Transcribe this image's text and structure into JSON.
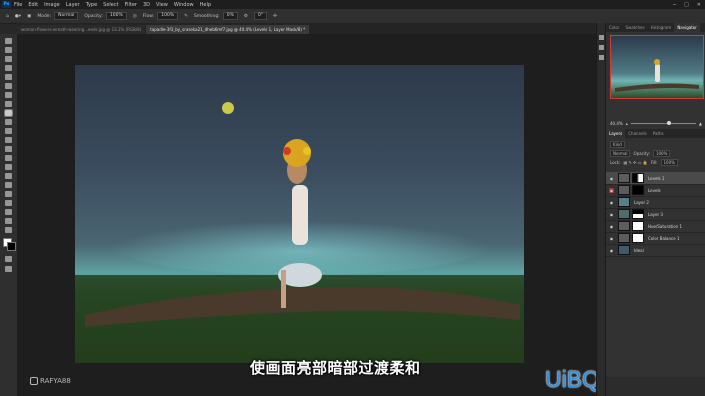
{
  "menu": [
    "File",
    "Edit",
    "Image",
    "Layer",
    "Type",
    "Select",
    "Filter",
    "3D",
    "View",
    "Window",
    "Help"
  ],
  "app_logo": "Ps",
  "options": {
    "mode_label": "Mode:",
    "mode_value": "Normal",
    "opacity_label": "Opacity:",
    "opacity_value": "100%",
    "flow_label": "Flow:",
    "flow_value": "100%",
    "smoothing_label": "Smoothing:",
    "smoothing_value": "0%",
    "angle_value": "0°"
  },
  "doc_tabs": [
    "woman-flowers-wreath-wearing...eeds.jpg @ 13.1% (RGB/8)",
    "tapadle-3f3_by_sraseka21_dheb6mf7.jpg @ 40.4% (Levels 1, Layer Mask/8) *"
  ],
  "panels": {
    "top_tabs": [
      "Color",
      "Swatches",
      "Histogram",
      "Navigator"
    ],
    "zoom_value": "40.4%",
    "layer_tabs": [
      "Layers",
      "Channels",
      "Paths"
    ],
    "kind_label": "Kind",
    "blend_value": "Normal",
    "opacity_label": "Opacity:",
    "opacity_value": "100%",
    "lock_label": "Lock:",
    "fill_label": "Fill:",
    "fill_value": "100%",
    "layers": [
      {
        "name": "Levels 1"
      },
      {
        "name": "Levels"
      },
      {
        "name": "Layer 2"
      },
      {
        "name": "Layer 3"
      },
      {
        "name": "Hue/Saturation 1"
      },
      {
        "name": "Color Balance 1"
      },
      {
        "name": "Ideal"
      }
    ]
  },
  "watermark": "RAFYA88",
  "subtitle": "使画面亮部暗部过渡柔和",
  "site_logo": "UiBQ.CoM",
  "colors": {
    "selection": "#4a4a4a",
    "accent": "#31a8ff",
    "nav_frame": "#d23b3b"
  }
}
